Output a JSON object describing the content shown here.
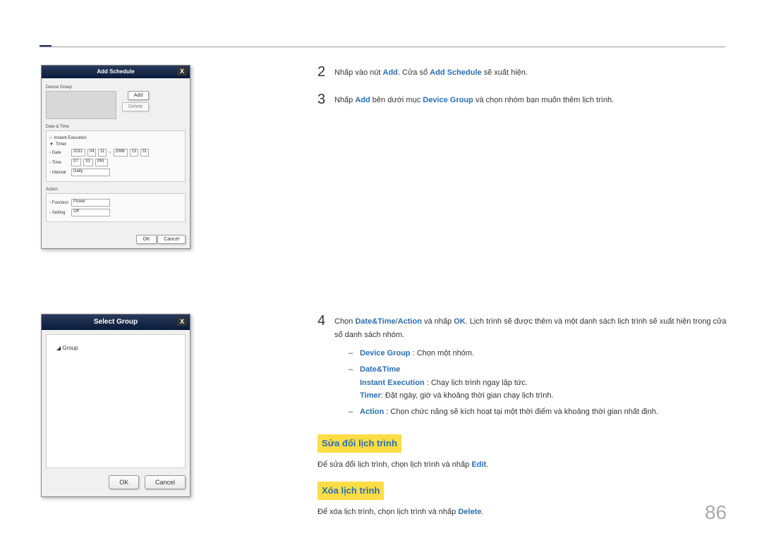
{
  "page_number": "86",
  "screenshot1": {
    "title": "Add Schedule",
    "section_device_group": "Device Group",
    "btn_add": "Add",
    "btn_delete": "Delete",
    "section_datetime": "Date & Time",
    "instant_execution": "Instant Execution",
    "timer": "Timer",
    "row_date": "Date",
    "date_from_y": "2011",
    "date_from_m": "04",
    "date_from_d": "11",
    "date_to_y": "2086",
    "date_to_m": "13",
    "date_to_d": "31",
    "row_time": "Time",
    "time_h": "07",
    "time_m": "33",
    "time_ampm": "PM",
    "row_interval": "Interval",
    "interval_val": "Daily",
    "section_action": "Action",
    "row_function": "Function",
    "function_val": "Power",
    "row_setting": "Setting",
    "setting_val": "Off",
    "btn_ok": "OK",
    "btn_cancel": "Cancel"
  },
  "screenshot2": {
    "title": "Select Group",
    "group_label": "Group",
    "btn_ok": "OK",
    "btn_cancel": "Cancel"
  },
  "step2": {
    "num": "2",
    "t1": "Nhấp vào nút ",
    "b1": "Add",
    "t2": ". Cửa sổ ",
    "b2": "Add Schedule",
    "t3": " sẽ xuất hiện."
  },
  "step3": {
    "num": "3",
    "t1": "Nhấp ",
    "b1": "Add",
    "t2": " bên dưới mục ",
    "b2": "Device Group",
    "t3": " và chọn nhóm bạn muốn thêm lịch trình."
  },
  "step4": {
    "num": "4",
    "t1": "Chọn ",
    "b1": "Date&Time",
    "slash": "/",
    "b2": "Action",
    "t2": " và nhấp ",
    "b3": "OK",
    "t3": ". Lịch trình sẽ được thêm và một danh sách lịch trình sẽ xuất hiện trong cửa sổ danh sách nhóm.",
    "sub1_label": "Device Group",
    "sub1_text": " : Chọn một nhóm.",
    "sub2_label": "Date&Time",
    "sub2a_label": "Instant Execution",
    "sub2a_text": " : Chạy lịch trình ngay lập tức.",
    "sub2b_label": "Timer",
    "sub2b_text": ": Đặt ngày, giờ và khoảng thời gian chạy lịch trình.",
    "sub3_label": "Action",
    "sub3_text": " : Chọn chức năng sẽ kích hoạt tại một thời điểm và khoảng thời gian nhất định."
  },
  "edit_section": {
    "heading": "Sửa đổi lịch trình",
    "t1": "Để sửa đổi lịch trình, chọn lịch trình và nhấp ",
    "b1": "Edit",
    "t2": "."
  },
  "delete_section": {
    "heading": "Xóa lịch trình",
    "t1": "Để xóa lịch trình, chọn lịch trình và nhấp ",
    "b1": "Delete",
    "t2": "."
  }
}
